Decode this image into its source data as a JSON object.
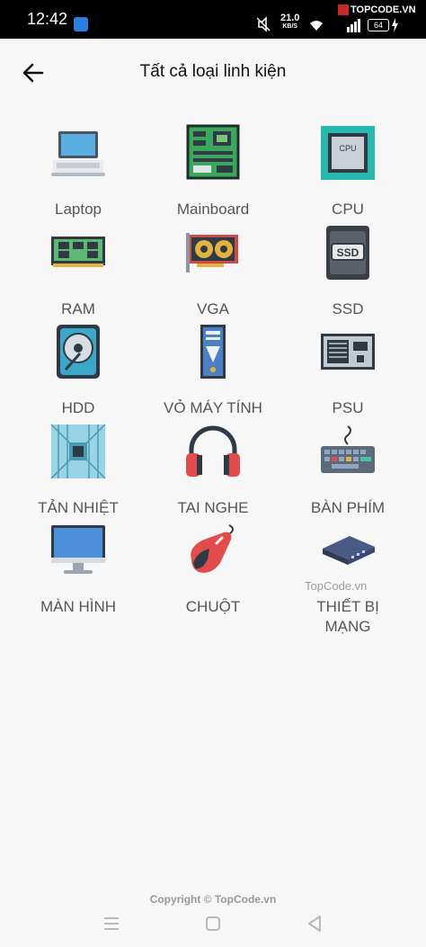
{
  "status_bar": {
    "time": "12:42",
    "net_speed_value": "21.0",
    "net_speed_unit": "KB/S",
    "battery": "64",
    "brand": "TOPCODE.VN"
  },
  "header": {
    "title": "Tất cả loại linh kiện"
  },
  "categories": [
    {
      "label": "Laptop",
      "icon": "laptop-icon"
    },
    {
      "label": "Mainboard",
      "icon": "mainboard-icon"
    },
    {
      "label": "CPU",
      "icon": "cpu-icon"
    },
    {
      "label": "RAM",
      "icon": "ram-icon"
    },
    {
      "label": "VGA",
      "icon": "vga-icon"
    },
    {
      "label": "SSD",
      "icon": "ssd-icon"
    },
    {
      "label": "HDD",
      "icon": "hdd-icon"
    },
    {
      "label": "VỎ MÁY TÍNH",
      "icon": "pc-case-icon"
    },
    {
      "label": "PSU",
      "icon": "psu-icon"
    },
    {
      "label": "TẢN NHIỆT",
      "icon": "cooler-icon"
    },
    {
      "label": "TAI NGHE",
      "icon": "headphones-icon"
    },
    {
      "label": "BÀN PHÍM",
      "icon": "keyboard-icon"
    },
    {
      "label": "MÀN HÌNH",
      "icon": "monitor-icon"
    },
    {
      "label": "CHUỘT",
      "icon": "mouse-icon"
    },
    {
      "label": "THIẾT BỊ MẠNG",
      "icon": "network-device-icon"
    }
  ],
  "watermark": "TopCode.vn",
  "copyright": "Copyright © TopCode.vn",
  "cpu_icon_text": "CPU",
  "ssd_icon_text": "SSD"
}
